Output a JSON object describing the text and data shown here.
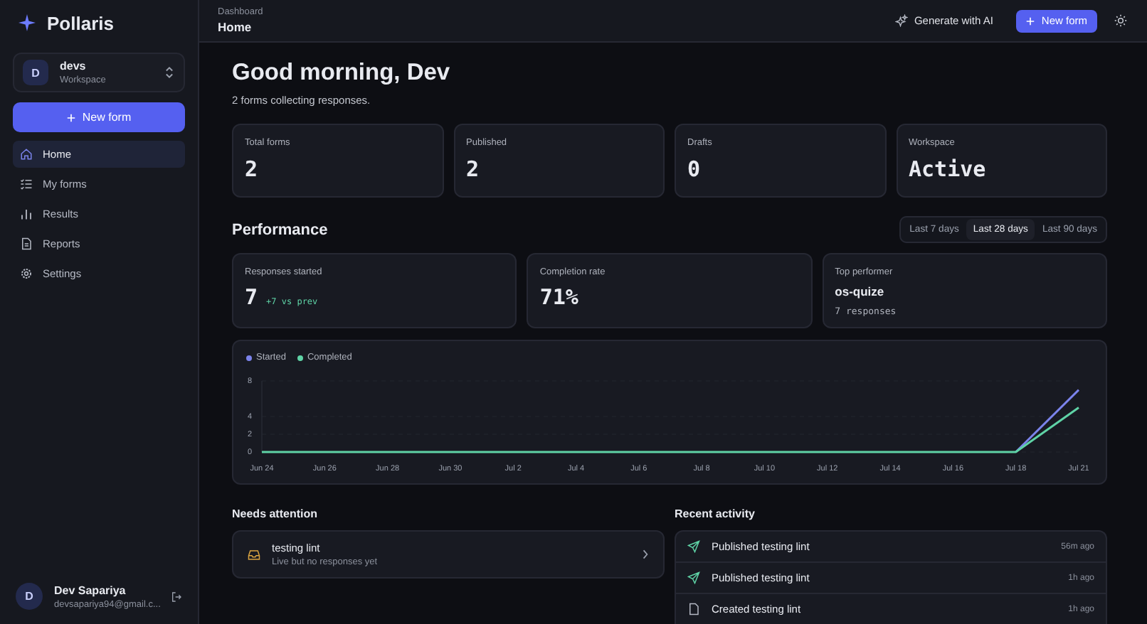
{
  "sidebar": {
    "brand": "Pollaris",
    "workspace": {
      "initial": "D",
      "name": "devs",
      "label": "Workspace"
    },
    "new_form": "New form",
    "items": [
      {
        "label": "Home",
        "selected": true
      },
      {
        "label": "My forms",
        "selected": false
      },
      {
        "label": "Results",
        "selected": false
      },
      {
        "label": "Reports",
        "selected": false
      },
      {
        "label": "Settings",
        "selected": false
      }
    ],
    "user": {
      "initial": "D",
      "name": "Dev Sapariya",
      "email": "devsapariya94@gmail.c..."
    }
  },
  "header": {
    "breadcrumb": "Dashboard",
    "title": "Home",
    "generate": "Generate with AI",
    "new_form": "New form"
  },
  "greeting": {
    "title": "Good morning, Dev",
    "subtitle": "2 forms collecting responses."
  },
  "stats": [
    {
      "label": "Total forms",
      "value": "2"
    },
    {
      "label": "Published",
      "value": "2"
    },
    {
      "label": "Drafts",
      "value": "0"
    },
    {
      "label": "Workspace",
      "value": "Active"
    }
  ],
  "performance": {
    "title": "Performance",
    "ranges": [
      {
        "label": "Last 7 days",
        "selected": false
      },
      {
        "label": "Last 28 days",
        "selected": true
      },
      {
        "label": "Last 90 days",
        "selected": false
      }
    ],
    "cards": [
      {
        "kind": "delta",
        "label": "Responses started",
        "value": "7",
        "delta": "+7 vs prev"
      },
      {
        "kind": "plain",
        "label": "Completion rate",
        "value": "71%"
      },
      {
        "kind": "top",
        "label": "Top performer",
        "value": "os-quize",
        "detail": "7 responses"
      }
    ],
    "chart_data": {
      "type": "line",
      "categories": [
        "Jun 24",
        "Jun 26",
        "Jun 28",
        "Jun 30",
        "Jul 2",
        "Jul 4",
        "Jul 6",
        "Jul 8",
        "Jul 10",
        "Jul 12",
        "Jul 14",
        "Jul 16",
        "Jul 18",
        "Jul 21"
      ],
      "yticks": [
        0,
        2,
        4,
        8
      ],
      "ylim": [
        0,
        8
      ],
      "legend": "top-left",
      "series": [
        {
          "name": "Started",
          "color": "#7b83eb",
          "values": [
            null,
            null,
            null,
            null,
            null,
            null,
            null,
            null,
            null,
            null,
            null,
            null,
            0,
            7
          ]
        },
        {
          "name": "Completed",
          "color": "#5fd3a6",
          "values": [
            0,
            0,
            0,
            0,
            0,
            0,
            0,
            0,
            0,
            0,
            0,
            0,
            0,
            5
          ]
        }
      ]
    }
  },
  "attention": {
    "title": "Needs attention",
    "items": [
      {
        "name": "testing lint",
        "note": "Live but no responses yet"
      }
    ]
  },
  "activity": {
    "title": "Recent activity",
    "items": [
      {
        "kind": "published",
        "text": "Published testing lint",
        "time": "56m ago"
      },
      {
        "kind": "published",
        "text": "Published testing lint",
        "time": "1h ago"
      },
      {
        "kind": "created",
        "text": "Created testing lint",
        "time": "1h ago"
      }
    ]
  }
}
